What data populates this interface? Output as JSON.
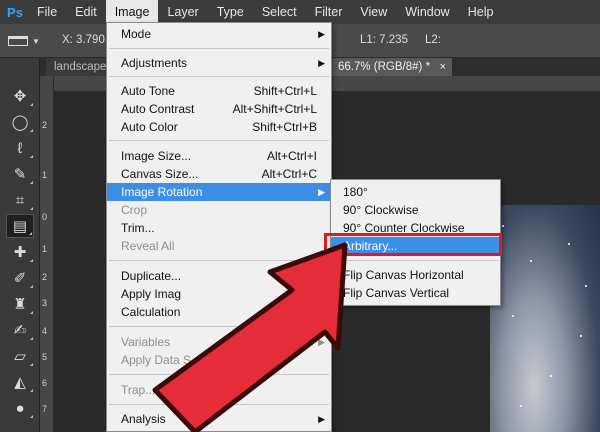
{
  "app_logo": "Ps",
  "menubar": {
    "items": [
      "File",
      "Edit",
      "Image",
      "Layer",
      "Type",
      "Select",
      "Filter",
      "View",
      "Window",
      "Help"
    ],
    "active": "Image"
  },
  "options_bar": {
    "x_label": "X: 3.790",
    "l1_label": "L1: 7.235",
    "l2_label": "L2:"
  },
  "tabs": [
    {
      "label": "landscape.jp"
    },
    {
      "label": "66.7% (RGB/8#) *",
      "close": "×"
    }
  ],
  "ruler": {
    "numbers": [
      "2",
      "1",
      "0",
      "1",
      "2",
      "3",
      "4",
      "5",
      "6",
      "7"
    ]
  },
  "image_menu": {
    "items": [
      {
        "label": "Mode",
        "shortcut": "",
        "submenu": true
      },
      {
        "label": "Adjustments",
        "shortcut": "",
        "submenu": true
      },
      {
        "label": "Auto Tone",
        "shortcut": "Shift+Ctrl+L"
      },
      {
        "label": "Auto Contrast",
        "shortcut": "Alt+Shift+Ctrl+L"
      },
      {
        "label": "Auto Color",
        "shortcut": "Shift+Ctrl+B"
      },
      {
        "label": "Image Size...",
        "shortcut": "Alt+Ctrl+I"
      },
      {
        "label": "Canvas Size...",
        "shortcut": "Alt+Ctrl+C"
      },
      {
        "label": "Image Rotation",
        "shortcut": "",
        "submenu": true,
        "highlighted": true
      },
      {
        "label": "Crop",
        "shortcut": "",
        "disabled": true
      },
      {
        "label": "Trim...",
        "shortcut": ""
      },
      {
        "label": "Reveal All",
        "shortcut": "",
        "disabled": true
      },
      {
        "label": "Duplicate...",
        "shortcut": ""
      },
      {
        "label": "Apply Imag",
        "shortcut": ""
      },
      {
        "label": "Calculation",
        "shortcut": ""
      },
      {
        "label": "Variables",
        "shortcut": "",
        "submenu": true,
        "disabled": true
      },
      {
        "label": "Apply Data S",
        "shortcut": "",
        "disabled": true
      },
      {
        "label": "Trap...",
        "shortcut": "",
        "disabled": true
      },
      {
        "label": "Analysis",
        "shortcut": "",
        "submenu": true
      }
    ]
  },
  "rotation_submenu": {
    "items": [
      {
        "label": "180°"
      },
      {
        "label": "90° Clockwise"
      },
      {
        "label": "90° Counter Clockwise"
      },
      {
        "label": "Arbitrary...",
        "highlighted": true
      },
      {
        "label": "Flip Canvas Horizontal"
      },
      {
        "label": "Flip Canvas Vertical"
      }
    ]
  },
  "annotation": {
    "arrow_color": "#e52d3a",
    "box_color": "#e01a22"
  }
}
